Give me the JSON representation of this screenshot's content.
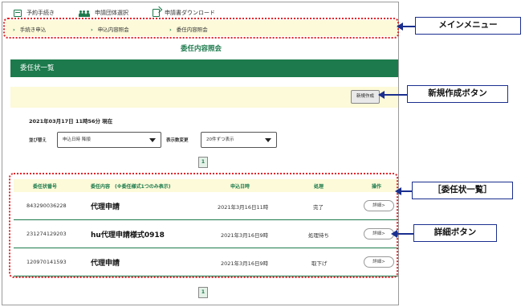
{
  "top_nav": [
    {
      "label": "予約手続き",
      "icon": "calendar-icon"
    },
    {
      "label": "申請団体選択",
      "icon": "people-icon"
    },
    {
      "label": "申請書ダウンロード",
      "icon": "document-download-icon"
    }
  ],
  "sub_menu": [
    {
      "label": "手続き申込"
    },
    {
      "label": "申込内容照会"
    },
    {
      "label": "委任内容照会"
    }
  ],
  "page_title": "委任内容照会",
  "section_title": "委任状一覧",
  "new_button_label": "新規作成",
  "datetime": "2021年03月17日 11時56分 現在",
  "sort": {
    "label": "並び替え",
    "value": "申込日時 降順",
    "display_label": "表示数変更",
    "display_value": "20件ずつ表示"
  },
  "pagination": {
    "current_top": "1",
    "current_bottom": "1"
  },
  "table": {
    "headers": [
      "委任状番号",
      "委任内容　(※委任様式1つのみ表示)",
      "申込日時",
      "処理",
      "操作"
    ],
    "rows": [
      {
        "number": "843290036228",
        "content": "代理申請",
        "date": "2021年3月16日11時",
        "status": "完了",
        "action": "詳細>"
      },
      {
        "number": "231274129203",
        "content": "hu代理申請様式0918",
        "date": "2021年3月16日9時",
        "status": "処理待ち",
        "action": "詳細>"
      },
      {
        "number": "120970141593",
        "content": "代理申請",
        "date": "2021年3月16日9時",
        "status": "取下げ",
        "action": "詳細>"
      }
    ]
  },
  "callouts": {
    "main_menu": "メインメニュー",
    "new_button": "新規作成ボタン",
    "list": "［委任状一覧］",
    "detail_button": "詳細ボタン"
  },
  "colors": {
    "brand_green": "#1c7a4c",
    "highlight_yellow": "#fcfad8",
    "annotation_red": "#e0262c",
    "callout_blue": "#1b2f8f"
  }
}
